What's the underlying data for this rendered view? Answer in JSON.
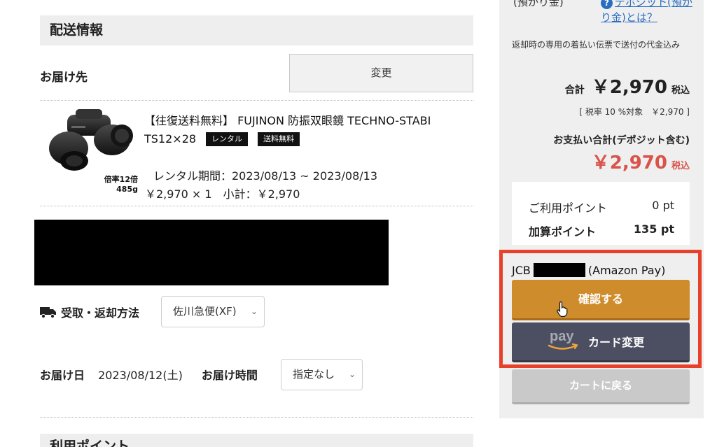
{
  "shipping": {
    "section_title": "配送情報",
    "destination_label": "お届け先",
    "change_button": "変更"
  },
  "product": {
    "title": "【往復送料無料】 FUJINON 防振双眼鏡 TECHNO-STABI TS12×28",
    "tag_rental": "レンタル",
    "tag_free_shipping": "送料無料",
    "image_note_magnification": "倍率12倍",
    "image_note_weight": "485g",
    "rental_period": "レンタル期間：2023/08/13 ~ 2023/08/13",
    "price_line": "￥2,970 × 1　小計：￥2,970"
  },
  "delivery_method": {
    "label": "受取・返却方法",
    "selected": "佐川急便(XF)"
  },
  "delivery_date": {
    "label": "お届け日",
    "value": "2023/08/12(土)",
    "time_label": "お届け時間",
    "time_selected": "指定なし"
  },
  "points_section_title": "利用ポイント",
  "summary": {
    "deposit_label": "(預かり金)",
    "deposit_link": "デポジット(預かり金)とは？",
    "return_note": "返却時の専用の着払い伝票で送付の代金込み",
    "total_label": "合計",
    "total_amount": "￥2,970",
    "tax_included": "税込",
    "tax_breakdown": "[ 税率 10 %対象　￥2,970 ]",
    "payment_total_label": "お支払い合計(デポジット含む)",
    "payment_total_amount": "￥2,970",
    "payment_tax_included": "税込",
    "points_used_label": "ご利用ポイント",
    "points_used_value": "0 pt",
    "points_added_label": "加算ポイント",
    "points_added_value": "135 pt"
  },
  "payment": {
    "card_brand": "JCB",
    "card_provider": "(Amazon Pay)",
    "confirm_button": "確認する",
    "amazon_pay_logo_text": "pay",
    "change_card_button": "カード変更",
    "back_to_cart_button": "カートに戻る"
  },
  "colors": {
    "confirm_button": "#cf8c2c",
    "amazon_button": "#4c4f61",
    "highlight_border": "#e8412b",
    "price_red": "#d9534a",
    "link_blue": "#2a6dc0"
  }
}
